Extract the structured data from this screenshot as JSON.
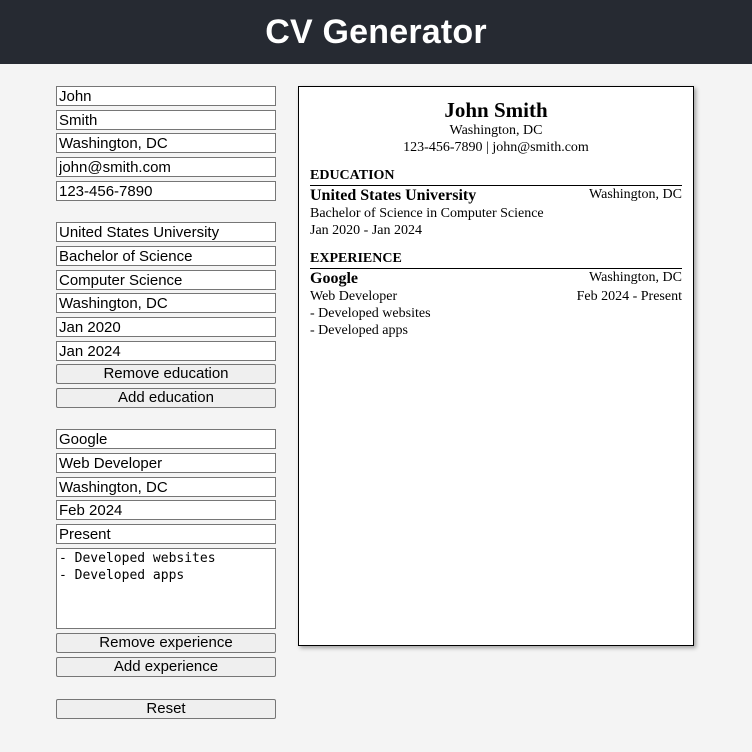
{
  "app": {
    "title": "CV Generator"
  },
  "form": {
    "personal": {
      "first_name": "John",
      "last_name": "Smith",
      "location": "Washington, DC",
      "email": "john@smith.com",
      "phone": "123-456-7890"
    },
    "education": {
      "school": "United States University",
      "degree": "Bachelor of Science",
      "field": "Computer Science",
      "location": "Washington, DC",
      "start": "Jan 2020",
      "end": "Jan 2024",
      "remove_label": "Remove education",
      "add_label": "Add education"
    },
    "experience": {
      "company": "Google",
      "position": "Web Developer",
      "location": "Washington, DC",
      "start": "Feb 2024",
      "end": "Present",
      "description": "- Developed websites\n- Developed apps",
      "remove_label": "Remove experience",
      "add_label": "Add experience"
    },
    "reset_label": "Reset"
  },
  "preview": {
    "name": "John Smith",
    "location": "Washington, DC",
    "phone": "123-456-7890",
    "separator": "|",
    "email": "john@smith.com",
    "education_heading": "EDUCATION",
    "education": {
      "school": "United States University",
      "location": "Washington, DC",
      "degree_line": "Bachelor of Science in Computer Science",
      "dates": "Jan 2020 - Jan 2024"
    },
    "experience_heading": "EXPERIENCE",
    "experience": {
      "company": "Google",
      "location": "Washington, DC",
      "position": "Web Developer",
      "dates": "Feb 2024 - Present",
      "bullets": [
        "- Developed websites",
        "- Developed apps"
      ]
    }
  }
}
